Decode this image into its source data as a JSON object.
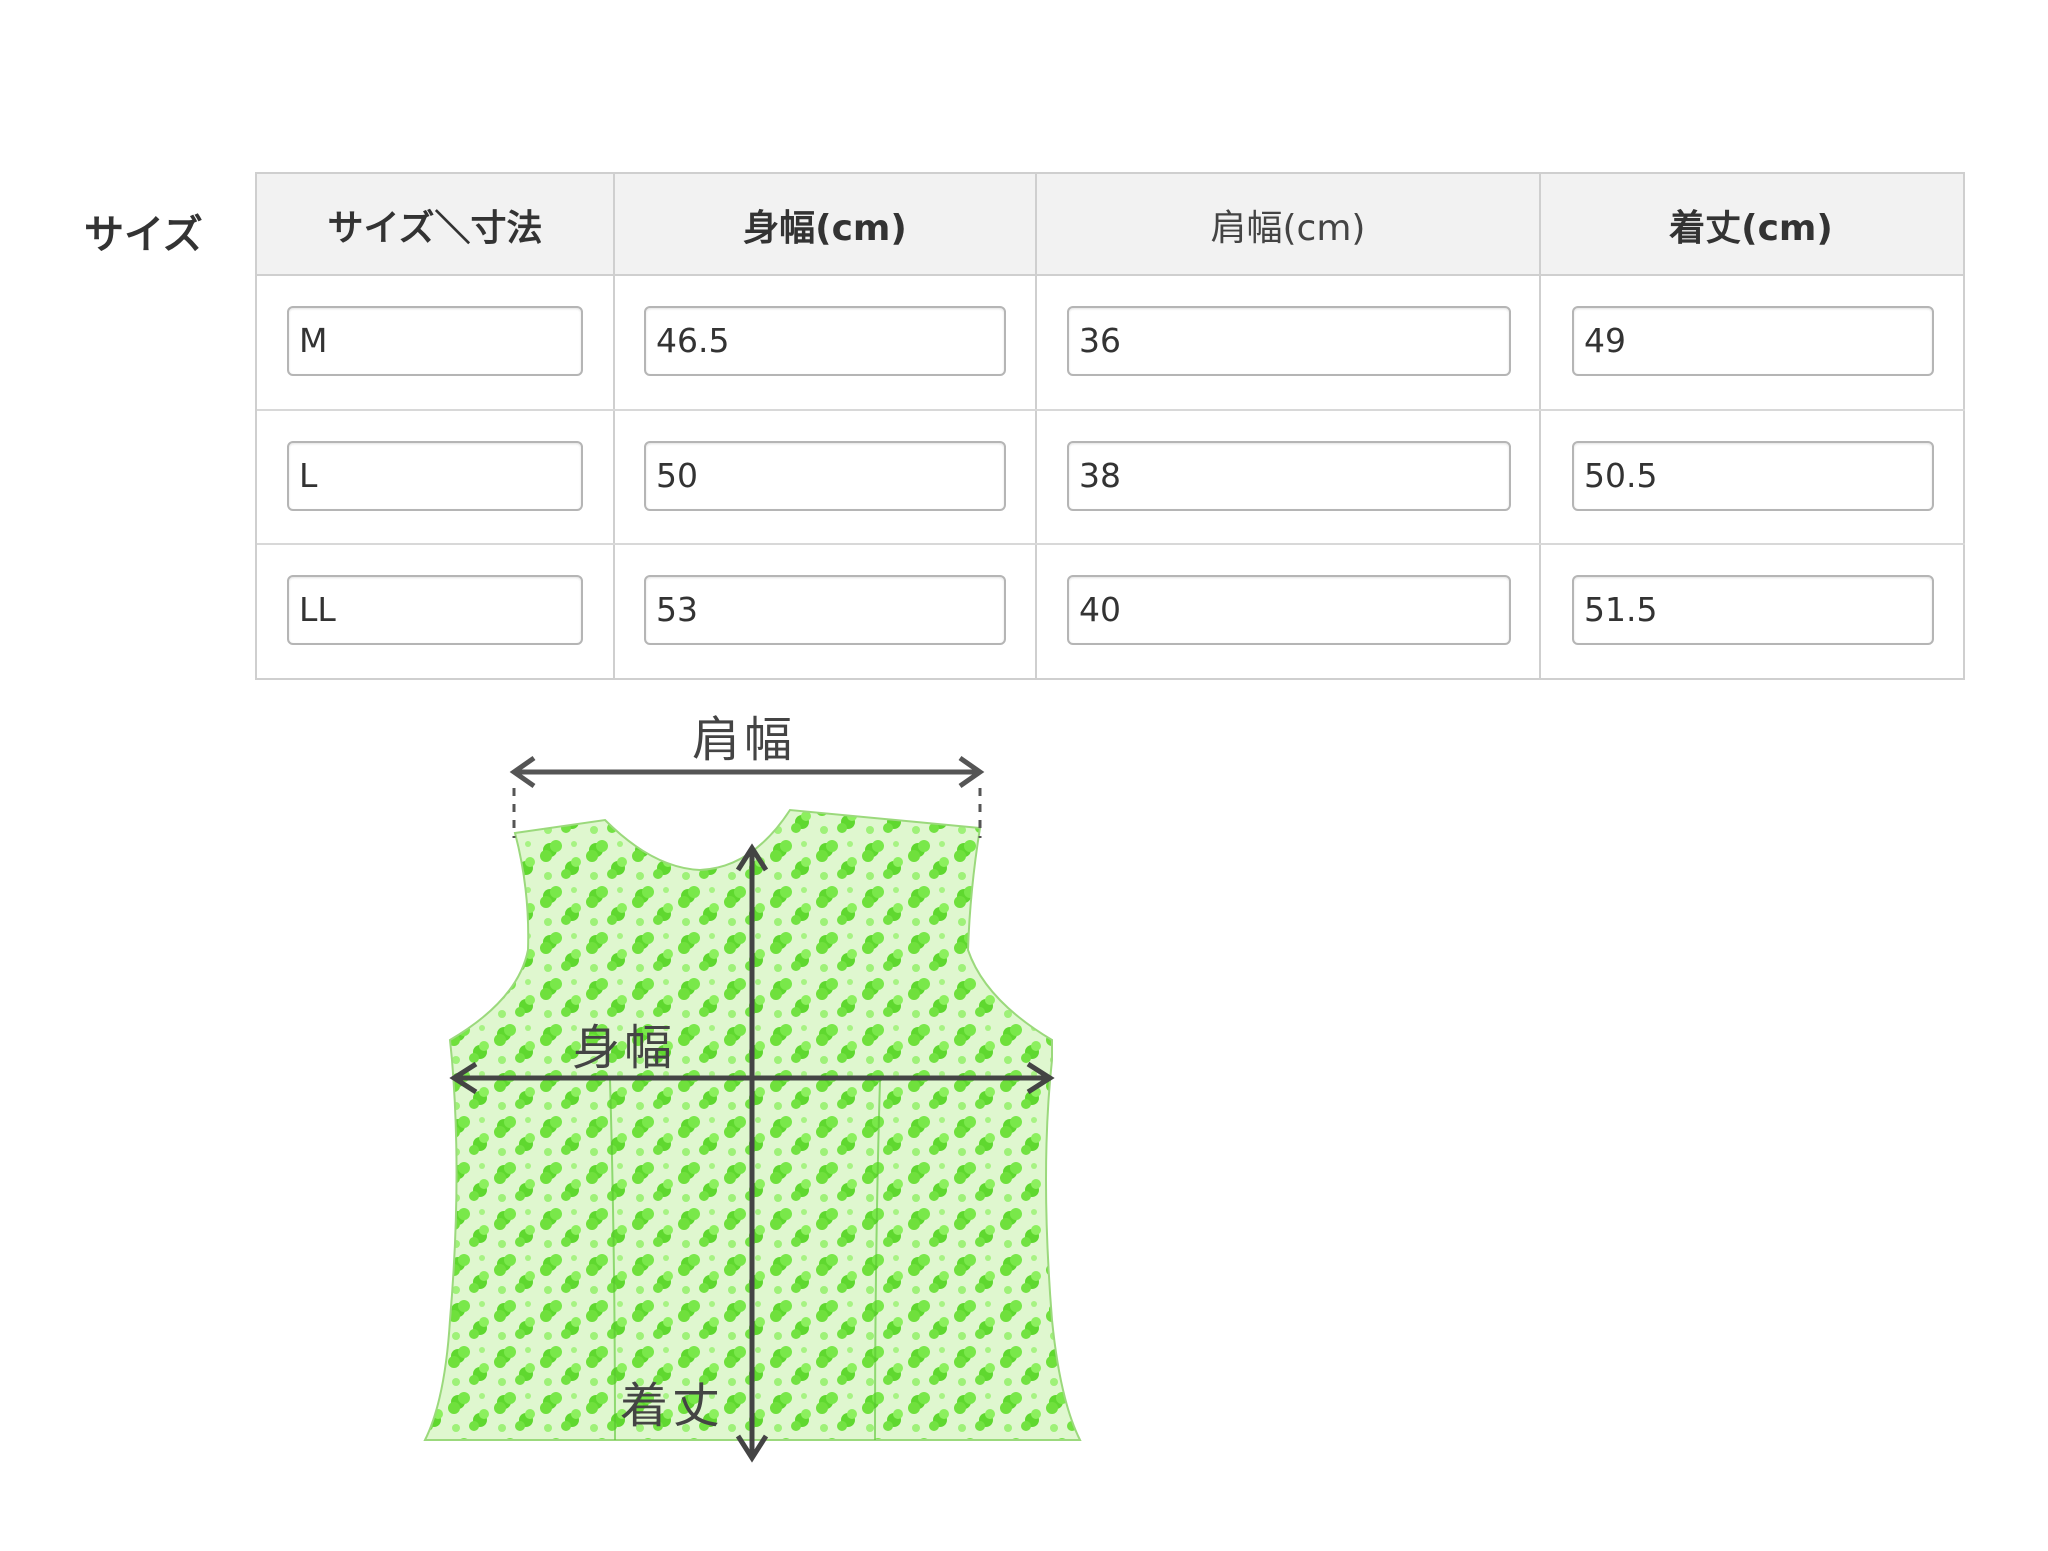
{
  "section_title": "サイズ",
  "table": {
    "headers": [
      "サイズ＼寸法",
      "身幅(cm)",
      "肩幅(cm)",
      "着丈(cm)"
    ],
    "rows": [
      [
        "M",
        "46.5",
        "36",
        "49"
      ],
      [
        "L",
        "50",
        "38",
        "50.5"
      ],
      [
        "LL",
        "53",
        "40",
        "51.5"
      ]
    ]
  },
  "diagram": {
    "shoulder_label": "肩幅",
    "width_label": "身幅",
    "length_label": "着丈",
    "garment_color": "#7ee84a",
    "arrow_color": "#555555"
  }
}
